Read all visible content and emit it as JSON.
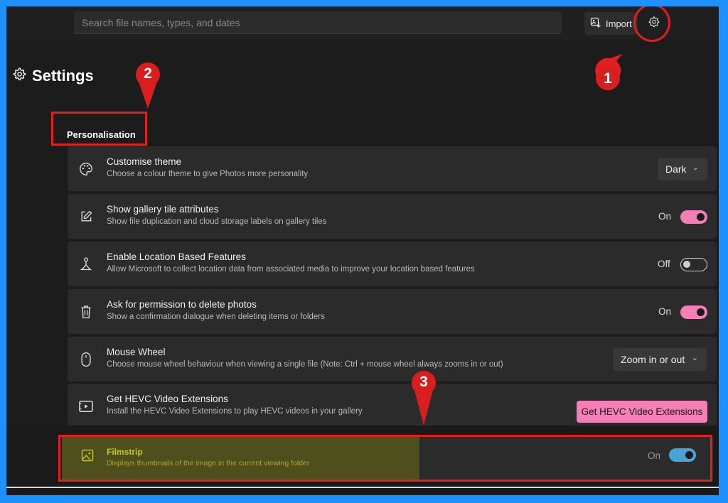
{
  "search": {
    "placeholder": "Search file names, types, and dates"
  },
  "toolbar": {
    "import_label": "Import"
  },
  "page": {
    "title": "Settings"
  },
  "section": {
    "label": "Personalisation"
  },
  "rows": [
    {
      "title": "Customise theme",
      "desc": "Choose a colour theme to give Photos more personality",
      "control": "dropdown",
      "value": "Dark"
    },
    {
      "title": "Show gallery tile attributes",
      "desc": "Show file duplication and cloud storage labels on gallery tiles",
      "control": "toggle",
      "state": "On"
    },
    {
      "title": "Enable Location Based Features",
      "desc": "Allow Microsoft to collect location data from associated media to improve your location based features",
      "control": "toggle",
      "state": "Off"
    },
    {
      "title": "Ask for permission to delete photos",
      "desc": "Show a confirmation dialogue when deleting items or folders",
      "control": "toggle",
      "state": "On"
    },
    {
      "title": "Mouse Wheel",
      "desc": "Choose mouse wheel behaviour when viewing a single file (Note: Ctrl + mouse wheel always zooms in or out)",
      "control": "dropdown",
      "value": "Zoom in or out"
    },
    {
      "title": "Get HEVC Video Extensions",
      "desc": "Install the HEVC Video Extensions to play HEVC videos in your gallery",
      "control": "button",
      "button_label": "Get HEVC Video Extensions"
    }
  ],
  "filmstrip": {
    "title": "Filmstrip",
    "desc": "Displays thumbnails of the image in the current viewing folder",
    "state": "On"
  },
  "annotations": [
    "1",
    "2",
    "3"
  ],
  "colors": {
    "accent_pink": "#f47eb6",
    "accent_blue": "#4aa3d6",
    "highlight_red": "#e02020",
    "frame_blue": "#1e90ff"
  }
}
